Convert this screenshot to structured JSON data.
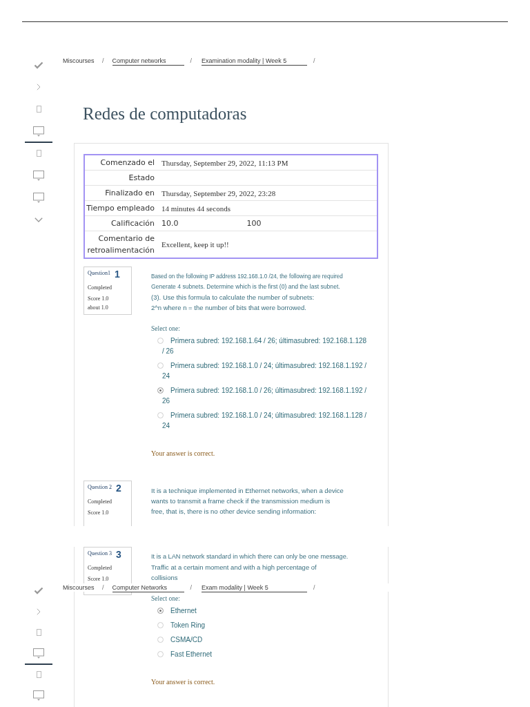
{
  "sections": [
    {
      "kind": "page_top",
      "sidebar": [
        {
          "kind": "check",
          "selected": false
        },
        {
          "kind": "chevron-right",
          "selected": false
        },
        {
          "kind": "page",
          "selected": false
        },
        {
          "kind": "monitor",
          "selected": true
        },
        {
          "kind": "page",
          "selected": false
        },
        {
          "kind": "monitor",
          "selected": false
        },
        {
          "kind": "monitor",
          "selected": false
        },
        {
          "kind": "chevron-down",
          "selected": false
        }
      ],
      "breadcrumb": [
        {
          "kind": "plain",
          "label": "Miscourses",
          "separator": "/"
        },
        {
          "kind": "link",
          "label": "Computer networks",
          "separator": "/"
        },
        {
          "kind": "link",
          "label": "Examination modality | Week 5",
          "separator": "/"
        }
      ],
      "title": "Redes de computadoras",
      "summary": [
        {
          "kind": "text",
          "label": "Comenzado el",
          "values": [
            "Thursday, September 29, 2022, 11:13 PM"
          ]
        },
        {
          "kind": "text",
          "label": "Estado"
        },
        {
          "kind": "text",
          "label": "Finalizado en",
          "values": [
            "Thursday, September 29, 2022, 23:28"
          ]
        },
        {
          "kind": "text",
          "label": "Tiempo empleado",
          "values": [
            "14 minutes 44 seconds"
          ]
        },
        {
          "kind": "grade",
          "label": "Calificación",
          "values": [
            "10.0",
            "100"
          ]
        },
        {
          "kind": "text",
          "label": "Comentario de retroalimentación",
          "values": [
            "Excellent, keep it up!!"
          ]
        }
      ],
      "questions": [
        {
          "number_label": "Question1",
          "number": "1",
          "status": "Completed",
          "score_lines": [
            "Score 1.0",
            "about 1.0"
          ],
          "prompt_lines": [
            "Based on the following IP address 192.168.1.0 /24, the following are required",
            "Generate 4 subnets. Determine which is the first (0) and the last subnet.",
            "(3). Use this formula to calculate the number of subnets:",
            "2^n where n = the number of bits that were borrowed."
          ],
          "select_label": "Select one:",
          "options": [
            {
              "label": "Primera subred: 192.168.1.64 / 26; últimasubred: 192.168.1.128 / 26",
              "selected": false
            },
            {
              "label": "Primera subred: 192.168.1.0 / 24; últimasubred: 192.168.1.192 / 24",
              "selected": false
            },
            {
              "label": "Primera subred: 192.168.1.0 / 26; últimasubred: 192.168.1.192 / 26",
              "selected": true
            },
            {
              "label": "Primera subred: 192.168.1.0 / 24; últimasubred: 192.168.1.128 / 24",
              "selected": false
            }
          ],
          "feedback": "Your answer is correct."
        },
        {
          "number_label": "Question 2",
          "number": "2",
          "status": "Completed",
          "score_lines": [
            "Score 1.0"
          ],
          "prompt_lines": [
            "It is a technique implemented in Ethernet networks, when a device",
            "wants to transmit a frame check if the transmission medium is",
            "free, that is, there is no other device sending information:"
          ]
        }
      ]
    },
    {
      "kind": "page_continued",
      "sidebar": [
        {
          "kind": "check",
          "selected": false
        },
        {
          "kind": "chevron-right",
          "selected": false
        },
        {
          "kind": "page",
          "selected": false
        },
        {
          "kind": "monitor",
          "selected": true
        },
        {
          "kind": "page",
          "selected": false
        },
        {
          "kind": "monitor",
          "selected": false
        }
      ],
      "breadcrumb": [
        {
          "kind": "plain",
          "label": "Miscourses",
          "separator": "/"
        },
        {
          "kind": "link",
          "label": "Computer Networks",
          "separator": "/"
        },
        {
          "kind": "link",
          "label": "Exam modality | Week 5",
          "separator": "/"
        }
      ],
      "questions": [
        {
          "number_label": "Question 3",
          "number": "3",
          "status": "Completed",
          "score_lines": [
            "Score 1.0"
          ],
          "prompt_lines": [
            "It is a LAN network standard in which there can only be one message.",
            "Traffic at a certain moment and with a high percentage of",
            "collisions"
          ],
          "select_label": "Select one:",
          "options": [
            {
              "label": "Ethernet",
              "selected": true
            },
            {
              "label": "Token Ring",
              "selected": false
            },
            {
              "label": "CSMA/CD",
              "selected": false
            },
            {
              "label": "Fast Ethernet",
              "selected": false
            }
          ],
          "feedback": "Your answer is correct."
        }
      ]
    }
  ]
}
